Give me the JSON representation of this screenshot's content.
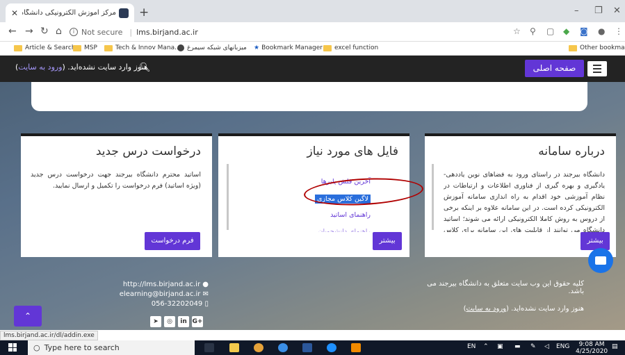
{
  "browser": {
    "tab_title": "مرکز آموزش الکترونیکی دانشگاه بیر",
    "new_tab": "+",
    "url_security": "Not secure",
    "url": "lms.birjand.ac.ir",
    "bookmarks": [
      {
        "label": "Article & Search",
        "icon": "folder-icon"
      },
      {
        "label": "MSP",
        "icon": "folder-icon"
      },
      {
        "label": "Tech & Innov Mana...",
        "icon": "folder-icon"
      },
      {
        "label": "میزبانهای شبکه سیمرغ",
        "icon": "globe-icon"
      },
      {
        "label": "Bookmark Manager",
        "icon": "star-icon"
      },
      {
        "label": "excel function",
        "icon": "folder-icon"
      }
    ],
    "other_bookmarks": "Other bookmarks"
  },
  "navbar": {
    "login_status": "هنوز وارد سایت نشده‌اید. (",
    "login_link": "ورود به سایت",
    "login_close": ")",
    "home_button": "صفحه اصلی"
  },
  "cards": {
    "about": {
      "title": "درباره سامانه",
      "body": "دانشگاه بیرجند در راستای ورود به فضاهای نوین یاددهی-یادگیری و بهره گیری از فناوری اطلاعات و ارتباطات در نظام آموزشی خود اقدام به راه اندازی سامانه آموزش الکترونیکی کرده است. در این سامانه علاوه بر اینکه برخی از دروس به روش کاملا الکترونیکی ارائه می شوند؛ اساتید دانشگاه می توانند از قابلیت های این سامانه برای کلاس های حضوری",
      "button": "بیشتر"
    },
    "files": {
      "title": "فایل های مورد نیاز",
      "links": [
        "آخرین فلش پلیرها",
        "لاگین کلاس مجازی",
        "راهنمای اساتید",
        "راهنمای دانشجویان"
      ],
      "button": "بیشتر"
    },
    "request": {
      "title": "درخواست درس جدید",
      "body": "اساتید محترم دانشگاه بیرجند جهت درخواست درس جدید (ویژه اساتید) فرم درخواست را تکمیل و ارسال نمایید.",
      "button": "فرم درخواست"
    }
  },
  "footer": {
    "site_url": "http://lms.birjand.ac.ir",
    "email": "elearning@birjand.ac.ir",
    "phone": "056-32202049",
    "copyright": "کلیه حقوق این وب سایت متعلق به دانشگاه بیرجند می باشد.",
    "login_status": "هنوز وارد سایت نشده‌اید. (",
    "login_link": "ورود به سایت",
    "login_close": ")",
    "socials": [
      "telegram-icon",
      "instagram-icon",
      "linkedin-icon",
      "google-plus-icon"
    ]
  },
  "status_url": "lms.birjand.ac.ir/dl/addin.exe",
  "taskbar": {
    "search_placeholder": "Type here to search",
    "lang_en": "EN",
    "lang_eng": "ENG",
    "time": "9:08 AM",
    "date": "4/25/2020"
  },
  "colors": {
    "accent": "#6236d6",
    "navbar": "#232323",
    "highlight": "#2a6edc",
    "annotation": "#b00000"
  }
}
